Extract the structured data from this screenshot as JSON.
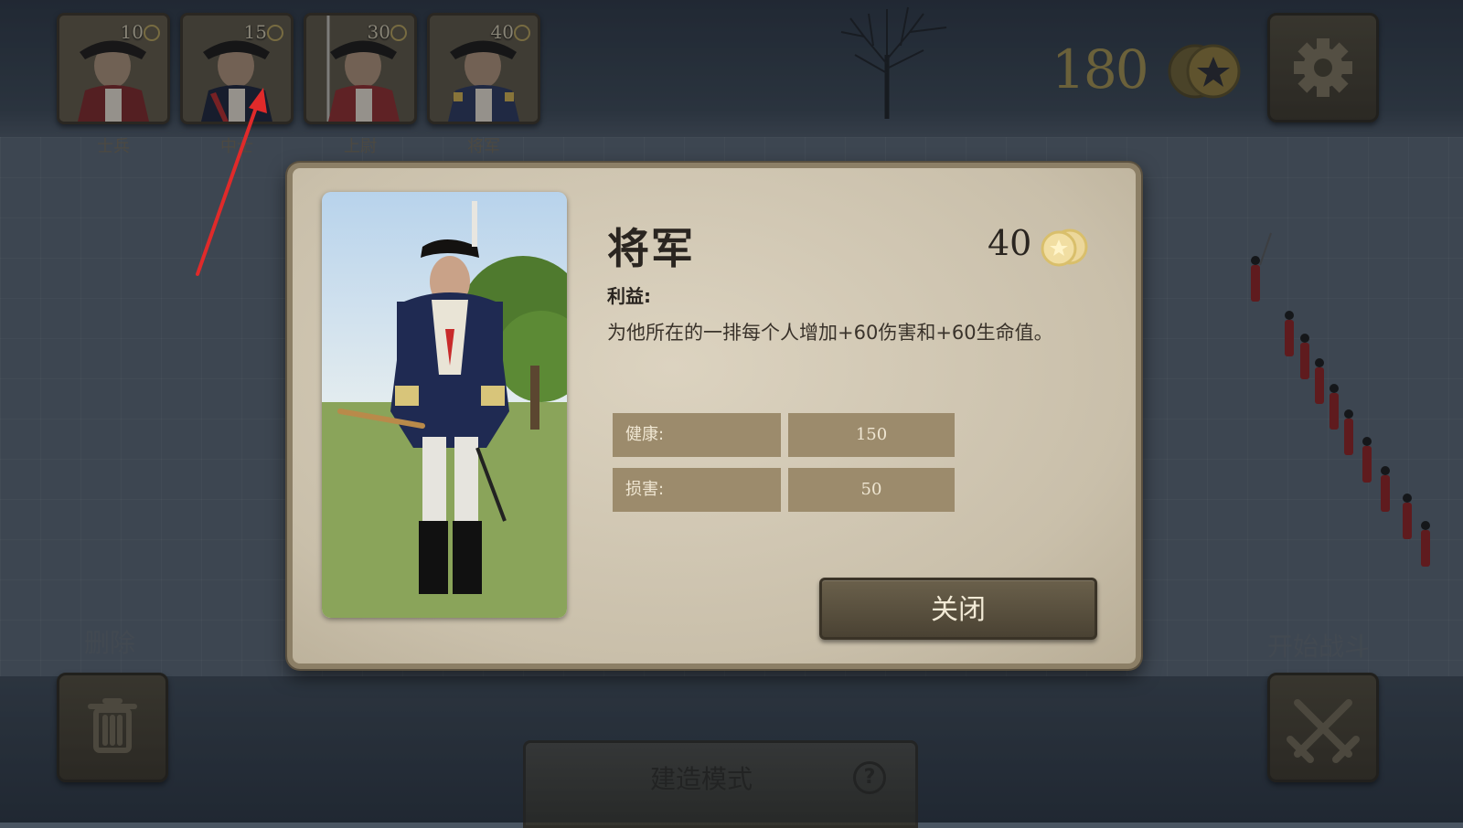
{
  "units": [
    {
      "name": "士兵",
      "cost": "10",
      "coat_color": "#7a2626"
    },
    {
      "name": "中士",
      "cost": "15",
      "coat_color": "#8a2a2a"
    },
    {
      "name": "上尉",
      "cost": "30",
      "coat_color": "#8a2a2a"
    },
    {
      "name": "将军",
      "cost": "40",
      "coat_color": "#2a3558"
    }
  ],
  "gold": {
    "amount": "180",
    "icon": "coin-stack-icon"
  },
  "settings": {
    "icon": "gear-icon"
  },
  "bottom": {
    "delete_label": "删除",
    "delete_icon": "trash-icon",
    "start_label": "开始战斗",
    "start_icon": "crossed-swords-icon",
    "build_mode_label": "建造模式",
    "help_glyph": "?"
  },
  "modal": {
    "title": "将军",
    "cost": "40",
    "benefit_label": "利益:",
    "benefit_text": "为他所在的一排每个人增加+60伤害和+60生命值。",
    "stats": [
      {
        "label": "健康:",
        "value": "150"
      },
      {
        "label": "损害:",
        "value": "50"
      }
    ],
    "close_label": "关闭"
  },
  "colors": {
    "accent_red": "#e02a2a",
    "gold": "#c9a94a"
  }
}
